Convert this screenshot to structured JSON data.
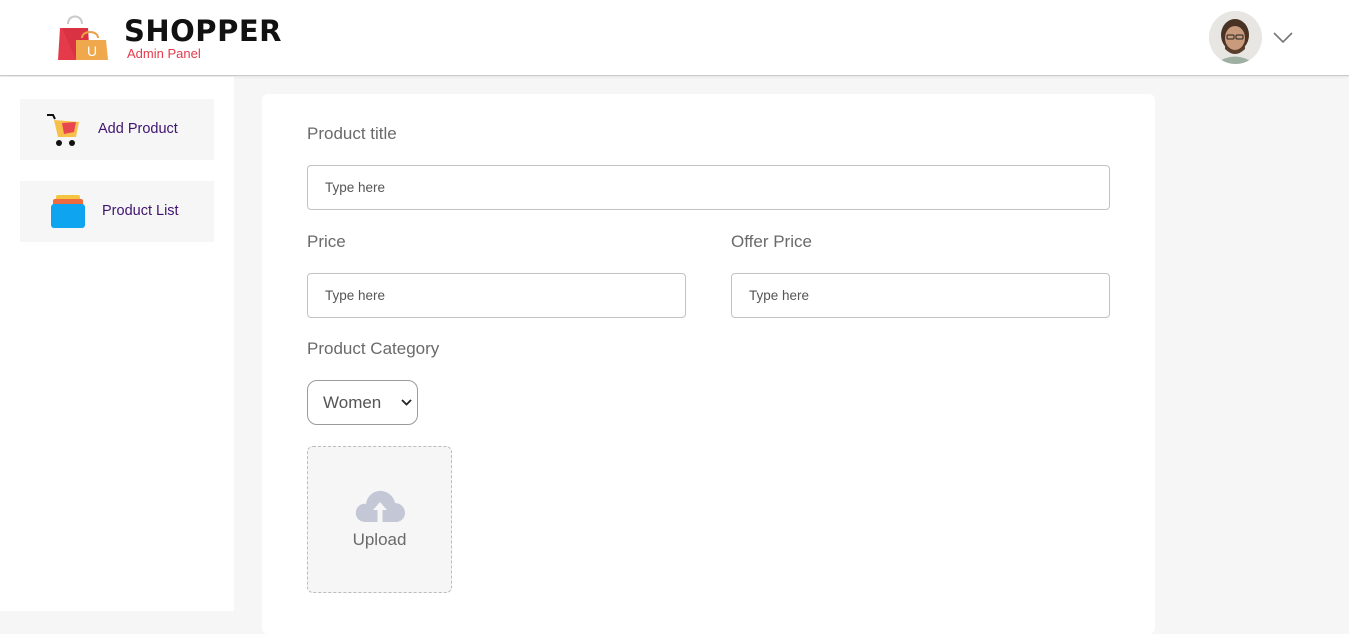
{
  "brand": {
    "title": "SHOPPER",
    "subtitle": "Admin Panel",
    "logo_letter": "U"
  },
  "profile": {
    "avatar": "profile-avatar",
    "menu_icon": "chevron-down-icon"
  },
  "sidebar": {
    "items": [
      {
        "label": "Add Product",
        "icon": "cart-icon"
      },
      {
        "label": "Product List",
        "icon": "product-list-icon"
      }
    ]
  },
  "form": {
    "title_label": "Product title",
    "title_placeholder": "Type here",
    "price_label": "Price",
    "price_placeholder": "Type here",
    "offer_label": "Offer Price",
    "offer_placeholder": "Type here",
    "category_label": "Product Category",
    "category_value": "Women",
    "upload_label": "Upload",
    "upload_icon": "cloud-upload-icon"
  },
  "colors": {
    "brand_subtitle": "#e6394b",
    "sidebar_label": "#3f1470",
    "page_background": "#f6f6f6"
  }
}
